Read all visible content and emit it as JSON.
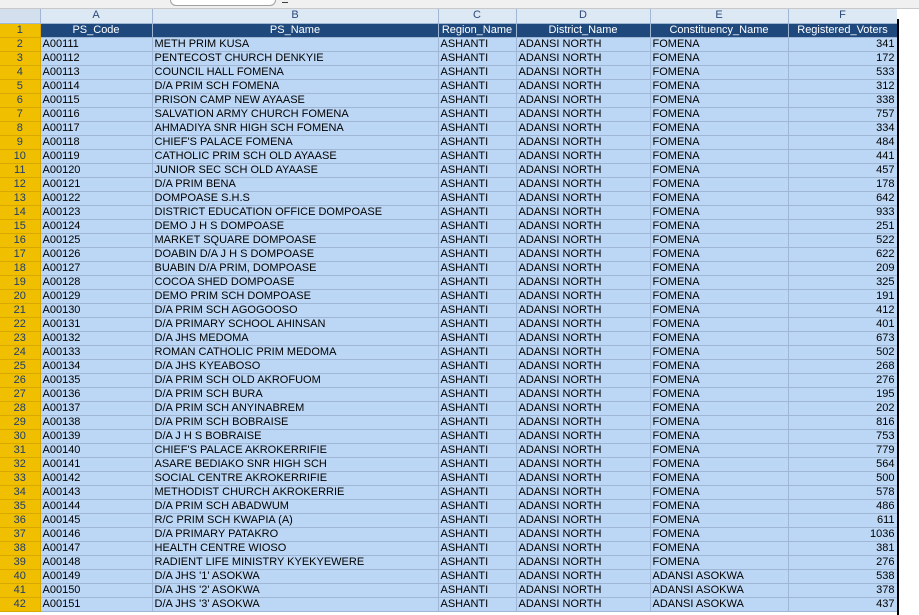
{
  "column_letters": [
    "A",
    "B",
    "C",
    "D",
    "E",
    "F"
  ],
  "headers": [
    "PS_Code",
    "PS_Name",
    "Region_Name",
    "District_Name",
    "Constituency_Name",
    "Registered_Voters"
  ],
  "header_row_number": "1",
  "rows": [
    {
      "n": "2",
      "code": "A00111",
      "name": "METH PRIM KUSA",
      "region": "ASHANTI",
      "district": "ADANSI NORTH",
      "constituency": "FOMENA",
      "voters": "341"
    },
    {
      "n": "3",
      "code": "A00112",
      "name": "PENTECOST CHURCH DENKYIE",
      "region": "ASHANTI",
      "district": "ADANSI NORTH",
      "constituency": "FOMENA",
      "voters": "172"
    },
    {
      "n": "4",
      "code": "A00113",
      "name": "COUNCIL HALL FOMENA",
      "region": "ASHANTI",
      "district": "ADANSI NORTH",
      "constituency": "FOMENA",
      "voters": "533"
    },
    {
      "n": "5",
      "code": "A00114",
      "name": "D/A PRIM SCH FOMENA",
      "region": "ASHANTI",
      "district": "ADANSI NORTH",
      "constituency": "FOMENA",
      "voters": "312"
    },
    {
      "n": "6",
      "code": "A00115",
      "name": "PRISON CAMP NEW AYAASE",
      "region": "ASHANTI",
      "district": "ADANSI NORTH",
      "constituency": "FOMENA",
      "voters": "338"
    },
    {
      "n": "7",
      "code": "A00116",
      "name": "SALVATION ARMY CHURCH FOMENA",
      "region": "ASHANTI",
      "district": "ADANSI NORTH",
      "constituency": "FOMENA",
      "voters": "757"
    },
    {
      "n": "8",
      "code": "A00117",
      "name": "AHMADIYA SNR HIGH SCH FOMENA",
      "region": "ASHANTI",
      "district": "ADANSI NORTH",
      "constituency": "FOMENA",
      "voters": "334"
    },
    {
      "n": "9",
      "code": "A00118",
      "name": "CHIEF'S PALACE FOMENA",
      "region": "ASHANTI",
      "district": "ADANSI NORTH",
      "constituency": "FOMENA",
      "voters": "484"
    },
    {
      "n": "10",
      "code": "A00119",
      "name": "CATHOLIC PRIM SCH OLD AYAASE",
      "region": "ASHANTI",
      "district": "ADANSI NORTH",
      "constituency": "FOMENA",
      "voters": "441"
    },
    {
      "n": "11",
      "code": "A00120",
      "name": "JUNIOR SEC SCH OLD AYAASE",
      "region": "ASHANTI",
      "district": "ADANSI NORTH",
      "constituency": "FOMENA",
      "voters": "457"
    },
    {
      "n": "12",
      "code": "A00121",
      "name": "D/A PRIM BENA",
      "region": "ASHANTI",
      "district": "ADANSI NORTH",
      "constituency": "FOMENA",
      "voters": "178"
    },
    {
      "n": "13",
      "code": "A00122",
      "name": "DOMPOASE S.H.S",
      "region": "ASHANTI",
      "district": "ADANSI NORTH",
      "constituency": "FOMENA",
      "voters": "642"
    },
    {
      "n": "14",
      "code": "A00123",
      "name": "DISTRICT EDUCATION OFFICE DOMPOASE",
      "region": "ASHANTI",
      "district": "ADANSI NORTH",
      "constituency": "FOMENA",
      "voters": "933"
    },
    {
      "n": "15",
      "code": "A00124",
      "name": "DEMO J H S DOMPOASE",
      "region": "ASHANTI",
      "district": "ADANSI NORTH",
      "constituency": "FOMENA",
      "voters": "251"
    },
    {
      "n": "16",
      "code": "A00125",
      "name": "MARKET SQUARE DOMPOASE",
      "region": "ASHANTI",
      "district": "ADANSI NORTH",
      "constituency": "FOMENA",
      "voters": "522"
    },
    {
      "n": "17",
      "code": "A00126",
      "name": "DOABIN D/A J H S DOMPOASE",
      "region": "ASHANTI",
      "district": "ADANSI NORTH",
      "constituency": "FOMENA",
      "voters": "622"
    },
    {
      "n": "18",
      "code": "A00127",
      "name": "BUABIN D/A PRIM, DOMPOASE",
      "region": "ASHANTI",
      "district": "ADANSI NORTH",
      "constituency": "FOMENA",
      "voters": "209"
    },
    {
      "n": "19",
      "code": "A00128",
      "name": "COCOA SHED DOMPOASE",
      "region": "ASHANTI",
      "district": "ADANSI NORTH",
      "constituency": "FOMENA",
      "voters": "325"
    },
    {
      "n": "20",
      "code": "A00129",
      "name": "DEMO PRIM SCH DOMPOASE",
      "region": "ASHANTI",
      "district": "ADANSI NORTH",
      "constituency": "FOMENA",
      "voters": "191"
    },
    {
      "n": "21",
      "code": "A00130",
      "name": "D/A PRIM SCH AGOGOOSO",
      "region": "ASHANTI",
      "district": "ADANSI NORTH",
      "constituency": "FOMENA",
      "voters": "412"
    },
    {
      "n": "22",
      "code": "A00131",
      "name": "D/A PRIMARY SCHOOL AHINSAN",
      "region": "ASHANTI",
      "district": "ADANSI NORTH",
      "constituency": "FOMENA",
      "voters": "401"
    },
    {
      "n": "23",
      "code": "A00132",
      "name": "D/A JHS MEDOMA",
      "region": "ASHANTI",
      "district": "ADANSI NORTH",
      "constituency": "FOMENA",
      "voters": "673"
    },
    {
      "n": "24",
      "code": "A00133",
      "name": "ROMAN CATHOLIC PRIM MEDOMA",
      "region": "ASHANTI",
      "district": "ADANSI NORTH",
      "constituency": "FOMENA",
      "voters": "502"
    },
    {
      "n": "25",
      "code": "A00134",
      "name": "D/A JHS KYEABOSO",
      "region": "ASHANTI",
      "district": "ADANSI NORTH",
      "constituency": "FOMENA",
      "voters": "268"
    },
    {
      "n": "26",
      "code": "A00135",
      "name": "D/A PRIM SCH OLD AKROFUOM",
      "region": "ASHANTI",
      "district": "ADANSI NORTH",
      "constituency": "FOMENA",
      "voters": "276"
    },
    {
      "n": "27",
      "code": "A00136",
      "name": "D/A PRIM SCH BURA",
      "region": "ASHANTI",
      "district": "ADANSI NORTH",
      "constituency": "FOMENA",
      "voters": "195"
    },
    {
      "n": "28",
      "code": "A00137",
      "name": "D/A PRIM SCH ANYINABREM",
      "region": "ASHANTI",
      "district": "ADANSI NORTH",
      "constituency": "FOMENA",
      "voters": "202"
    },
    {
      "n": "29",
      "code": "A00138",
      "name": "D/A PRIM SCH BOBRAISE",
      "region": "ASHANTI",
      "district": "ADANSI NORTH",
      "constituency": "FOMENA",
      "voters": "816"
    },
    {
      "n": "30",
      "code": "A00139",
      "name": "D/A J H S BOBRAISE",
      "region": "ASHANTI",
      "district": "ADANSI NORTH",
      "constituency": "FOMENA",
      "voters": "753"
    },
    {
      "n": "31",
      "code": "A00140",
      "name": "CHIEF'S PALACE AKROKERRIFIE",
      "region": "ASHANTI",
      "district": "ADANSI NORTH",
      "constituency": "FOMENA",
      "voters": "779"
    },
    {
      "n": "32",
      "code": "A00141",
      "name": "ASARE BEDIAKO SNR HIGH SCH",
      "region": "ASHANTI",
      "district": "ADANSI NORTH",
      "constituency": "FOMENA",
      "voters": "564"
    },
    {
      "n": "33",
      "code": "A00142",
      "name": "SOCIAL CENTRE AKROKERRIFIE",
      "region": "ASHANTI",
      "district": "ADANSI NORTH",
      "constituency": "FOMENA",
      "voters": "500"
    },
    {
      "n": "34",
      "code": "A00143",
      "name": "METHODIST CHURCH AKROKERRIE",
      "region": "ASHANTI",
      "district": "ADANSI NORTH",
      "constituency": "FOMENA",
      "voters": "578"
    },
    {
      "n": "35",
      "code": "A00144",
      "name": "D/A PRIM SCH ABADWUM",
      "region": "ASHANTI",
      "district": "ADANSI NORTH",
      "constituency": "FOMENA",
      "voters": "486"
    },
    {
      "n": "36",
      "code": "A00145",
      "name": "R/C PRIM SCH KWAPIA (A)",
      "region": "ASHANTI",
      "district": "ADANSI NORTH",
      "constituency": "FOMENA",
      "voters": "611"
    },
    {
      "n": "37",
      "code": "A00146",
      "name": "D/A PRIMARY PATAKRO",
      "region": "ASHANTI",
      "district": "ADANSI NORTH",
      "constituency": "FOMENA",
      "voters": "1036"
    },
    {
      "n": "38",
      "code": "A00147",
      "name": "HEALTH CENTRE WIOSO",
      "region": "ASHANTI",
      "district": "ADANSI NORTH",
      "constituency": "FOMENA",
      "voters": "381"
    },
    {
      "n": "39",
      "code": "A00148",
      "name": "RADIENT LIFE MINISTRY KYEKYEWERE",
      "region": "ASHANTI",
      "district": "ADANSI NORTH",
      "constituency": "FOMENA",
      "voters": "276"
    },
    {
      "n": "40",
      "code": "A00149",
      "name": "D/A JHS '1' ASOKWA",
      "region": "ASHANTI",
      "district": "ADANSI NORTH",
      "constituency": "ADANSI ASOKWA",
      "voters": "538"
    },
    {
      "n": "41",
      "code": "A00150",
      "name": "D/A JHS '2' ASOKWA",
      "region": "ASHANTI",
      "district": "ADANSI NORTH",
      "constituency": "ADANSI ASOKWA",
      "voters": "378"
    },
    {
      "n": "42",
      "code": "A00151",
      "name": "D/A JHS '3' ASOKWA",
      "region": "ASHANTI",
      "district": "ADANSI NORTH",
      "constituency": "ADANSI ASOKWA",
      "voters": "437"
    }
  ]
}
